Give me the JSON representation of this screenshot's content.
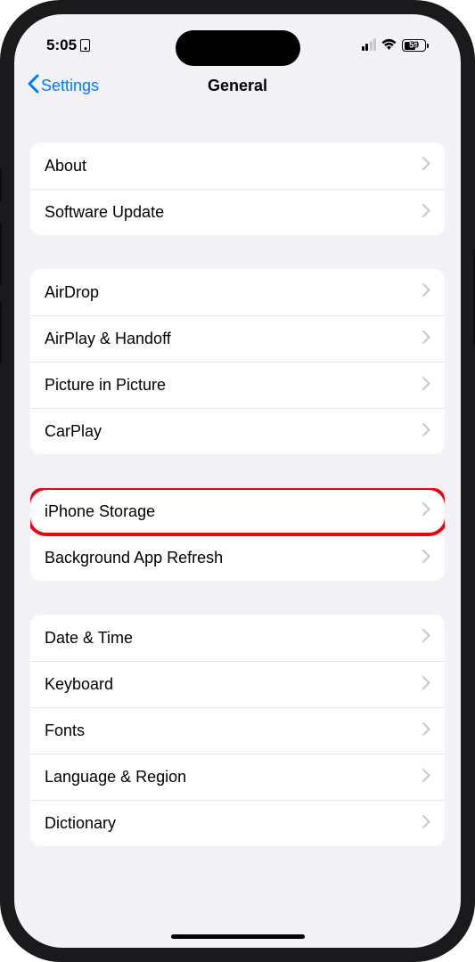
{
  "statusBar": {
    "time": "5:05",
    "battery": "59"
  },
  "nav": {
    "back": "Settings",
    "title": "General"
  },
  "groups": {
    "g1": [
      {
        "label": "About",
        "name": "row-about"
      },
      {
        "label": "Software Update",
        "name": "row-software-update"
      }
    ],
    "g2": [
      {
        "label": "AirDrop",
        "name": "row-airdrop"
      },
      {
        "label": "AirPlay & Handoff",
        "name": "row-airplay-handoff"
      },
      {
        "label": "Picture in Picture",
        "name": "row-picture-in-picture"
      },
      {
        "label": "CarPlay",
        "name": "row-carplay"
      }
    ],
    "g3": [
      {
        "label": "iPhone Storage",
        "name": "row-iphone-storage",
        "highlight": true
      },
      {
        "label": "Background App Refresh",
        "name": "row-background-app-refresh"
      }
    ],
    "g4": [
      {
        "label": "Date & Time",
        "name": "row-date-time"
      },
      {
        "label": "Keyboard",
        "name": "row-keyboard"
      },
      {
        "label": "Fonts",
        "name": "row-fonts"
      },
      {
        "label": "Language & Region",
        "name": "row-language-region"
      },
      {
        "label": "Dictionary",
        "name": "row-dictionary"
      }
    ]
  }
}
